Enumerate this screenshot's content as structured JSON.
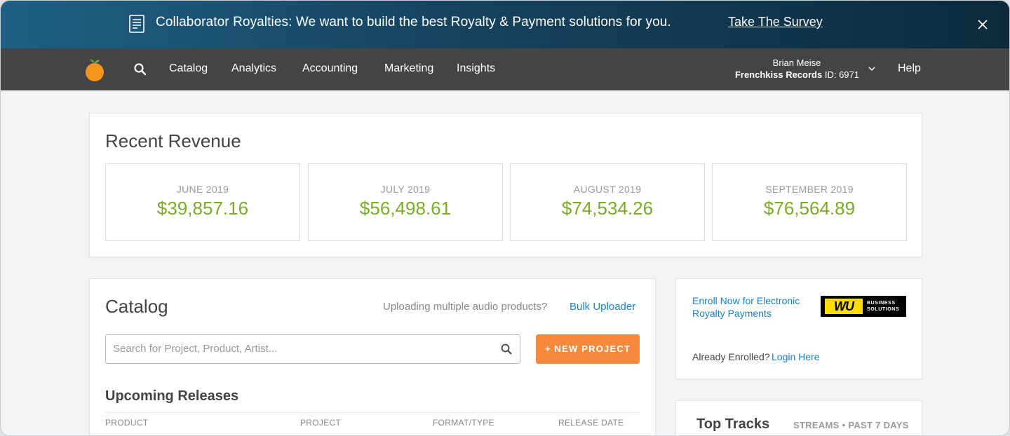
{
  "banner": {
    "text": "Collaborator Royalties: We want to build the best Royalty & Payment solutions for you.",
    "link": "Take The Survey",
    "icon": "document-icon",
    "close_icon": "close-icon",
    "gradient": [
      "#1e5f85",
      "#0d2a3c"
    ]
  },
  "nav": {
    "logo": "orange-logo",
    "search_icon": "search-icon",
    "items": [
      "Catalog",
      "Analytics",
      "Accounting",
      "Marketing",
      "Insights"
    ],
    "user": {
      "name": "Brian Meise",
      "company": "Frenchkiss Records",
      "id_label": "ID: 6971"
    },
    "help": "Help"
  },
  "revenue": {
    "title": "Recent Revenue",
    "months": [
      {
        "label": "JUNE 2019",
        "amount": "$39,857.16"
      },
      {
        "label": "JULY 2019",
        "amount": "$56,498.61"
      },
      {
        "label": "AUGUST 2019",
        "amount": "$74,534.26"
      },
      {
        "label": "SEPTEMBER 2019",
        "amount": "$76,564.89"
      }
    ],
    "amount_color": "#7cab2c"
  },
  "catalog": {
    "title": "Catalog",
    "bulk_prompt": "Uploading multiple audio products?",
    "bulk_link": "Bulk Uploader",
    "search_placeholder": "Search for Project, Product, Artist...",
    "new_project": "+ NEW PROJECT",
    "upcoming_title": "Upcoming Releases",
    "columns": [
      "PRODUCT",
      "PROJECT",
      "FORMAT/TYPE",
      "RELEASE DATE"
    ]
  },
  "western_union": {
    "enroll": "Enroll Now for Electronic Royalty Payments",
    "logo_mark": "WU",
    "logo_sub": "BUSINESS SOLUTIONS",
    "already": "Already Enrolled?",
    "login": "Login Here"
  },
  "top_tracks": {
    "title": "Top Tracks",
    "subtitle": "STREAMS • PAST 7 DAYS"
  }
}
